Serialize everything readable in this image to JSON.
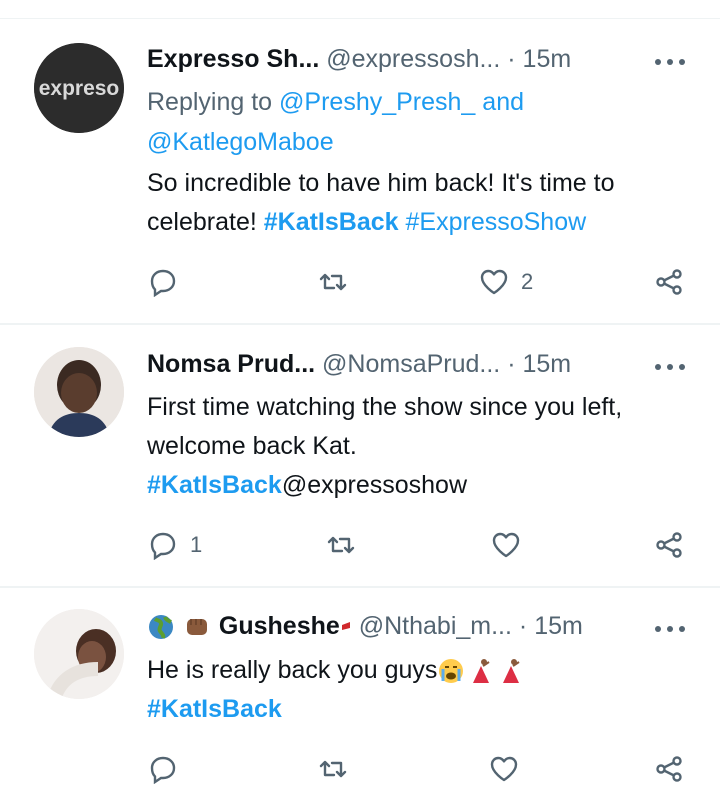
{
  "tweets": [
    {
      "avatar_text": "expreso",
      "name": "Expresso Sh...",
      "handle": "@expressosh...",
      "dot": "·",
      "time": "15m",
      "reply_prefix": "Replying to ",
      "reply_to_1": "@Preshy_Presh_",
      "reply_and": " and",
      "reply_to_2": "@KatlegoMaboe",
      "text_line1": "So incredible to have him back! It's time to",
      "text_line2_prefix": "celebrate! ",
      "hashtag1": "#KatIsBack",
      "hashtag2": "#ExpressoShow",
      "reply_count": "",
      "retweet_count": "",
      "like_count": "2"
    },
    {
      "name": "Nomsa Prud...",
      "handle": "@NomsaPrud...",
      "dot": "·",
      "time": "15m",
      "text_line1": "First time watching the show since you left,",
      "text_line2": "welcome back Kat.",
      "hashtag": "#KatIsBack",
      "mention": "@expressoshow",
      "reply_count": "1",
      "retweet_count": "",
      "like_count": ""
    },
    {
      "name": "Gusheshe",
      "handle": "@Nthabi_m...",
      "dot": "·",
      "time": "15m",
      "text_line1": "He is really back you guys",
      "hashtag": "#KatIsBack"
    }
  ],
  "colors": {
    "accent": "#1d9bf0",
    "secondary": "#536471",
    "divider": "#eff3f4"
  }
}
